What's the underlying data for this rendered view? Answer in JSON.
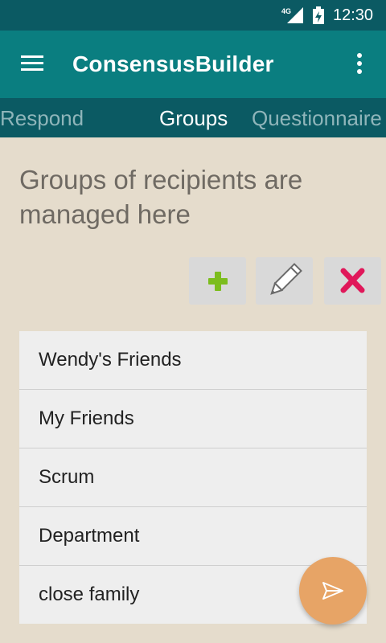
{
  "status_bar": {
    "network": "4G",
    "time": "12:30",
    "icons": [
      "signal-icon",
      "battery-icon"
    ]
  },
  "app_bar": {
    "title": "ConsensusBuilder",
    "icons": [
      "hamburger-menu-icon",
      "overflow-menu-icon"
    ]
  },
  "tabs": [
    {
      "label": "Respond",
      "active": false
    },
    {
      "label": "Groups",
      "active": true
    },
    {
      "label": "Questionnaire",
      "active": false
    }
  ],
  "main": {
    "heading": "Groups of recipients are managed here",
    "actions": [
      {
        "name": "add",
        "icon": "plus-icon",
        "color": "#7cbd1e"
      },
      {
        "name": "edit",
        "icon": "pencil-icon",
        "color": "#777777"
      },
      {
        "name": "delete",
        "icon": "cross-icon",
        "color": "#e0185a"
      }
    ],
    "groups": [
      {
        "label": "Wendy's Friends"
      },
      {
        "label": "My Friends"
      },
      {
        "label": "Scrum"
      },
      {
        "label": "Department"
      },
      {
        "label": "close family"
      }
    ]
  },
  "fab": {
    "icon": "send-icon"
  },
  "colors": {
    "status_bar": "#0b5a63",
    "app_bar": "#0a7e80",
    "tab_bar": "#0b5a63",
    "background": "#e5dccc",
    "fab": "#e7a466"
  }
}
